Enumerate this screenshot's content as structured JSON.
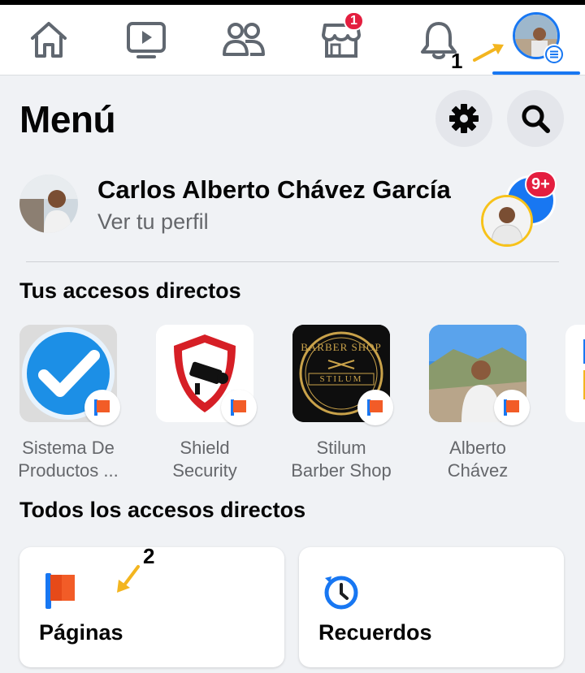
{
  "nav": {
    "items": [
      {
        "name": "home",
        "icon": "home-icon"
      },
      {
        "name": "watch",
        "icon": "video-icon"
      },
      {
        "name": "friends",
        "icon": "friends-icon"
      },
      {
        "name": "marketplace",
        "icon": "store-icon",
        "badge": "1"
      },
      {
        "name": "notifications",
        "icon": "bell-icon"
      },
      {
        "name": "menu",
        "icon": "profile-menu-icon"
      }
    ],
    "active": "menu",
    "marketplace_badge": "1"
  },
  "annotations": {
    "step1": "1",
    "step2": "2"
  },
  "header": {
    "title": "Menú"
  },
  "profile": {
    "name": "Carlos Alberto Chávez García",
    "subtitle": "Ver tu perfil",
    "switch_badge": "9+"
  },
  "shortcuts": {
    "title": "Tus accesos directos",
    "items": [
      {
        "label_line1": "Sistema De",
        "label_line2": "Productos ..."
      },
      {
        "label_line1": "Shield",
        "label_line2": "Security"
      },
      {
        "label_line1": "Stilum",
        "label_line2": "Barber Shop"
      },
      {
        "label_line1": "Alberto",
        "label_line2": "Chávez"
      }
    ],
    "barber_text": "BARBER SHOP",
    "barber_sub": "STILUM"
  },
  "all_shortcuts": {
    "title": "Todos los accesos directos",
    "cards": [
      {
        "label": "Páginas",
        "icon": "pages-flag-icon"
      },
      {
        "label": "Recuerdos",
        "icon": "memories-clock-icon"
      }
    ]
  },
  "colors": {
    "accent": "#1877f2",
    "badge": "#e41e3f",
    "flag": "#f25c27",
    "background": "#f0f2f5"
  }
}
